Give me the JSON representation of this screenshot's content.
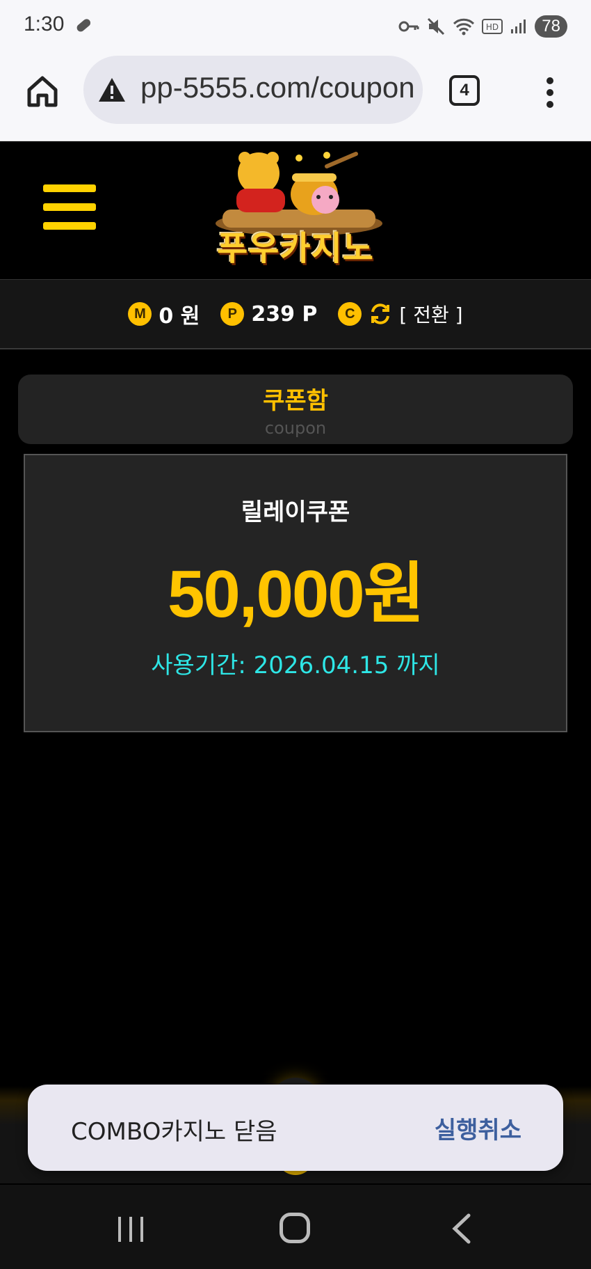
{
  "status_bar": {
    "time": "1:30",
    "battery": "78",
    "icons": [
      "vpn-key-icon",
      "mute-icon",
      "wifi-icon",
      "hd-icon",
      "signal-icon"
    ]
  },
  "browser": {
    "url": "pp-5555.com/coupon",
    "tab_count": "4",
    "icons": [
      "home-icon",
      "warning-icon",
      "tab-switcher-icon",
      "more-vert-icon"
    ]
  },
  "site": {
    "logo_text": "푸우카지노",
    "balances": {
      "money_coin": "M",
      "money_value": "0 원",
      "point_coin": "P",
      "point_value": "239 P",
      "c_coin": "C",
      "convert_label": "[ 전환 ]"
    }
  },
  "coupon_section": {
    "title": "쿠폰함",
    "subtitle": "coupon"
  },
  "coupon": {
    "name": "릴레이쿠폰",
    "amount": "50,000원",
    "expiry": "사용기간: 2026.04.15 까지"
  },
  "toast": {
    "message": "COMBO카지노 닫음",
    "action": "실행취소"
  },
  "colors": {
    "accent": "#ffc000",
    "expiry": "#2ee6e6",
    "toast_action": "#3d5f9e"
  }
}
